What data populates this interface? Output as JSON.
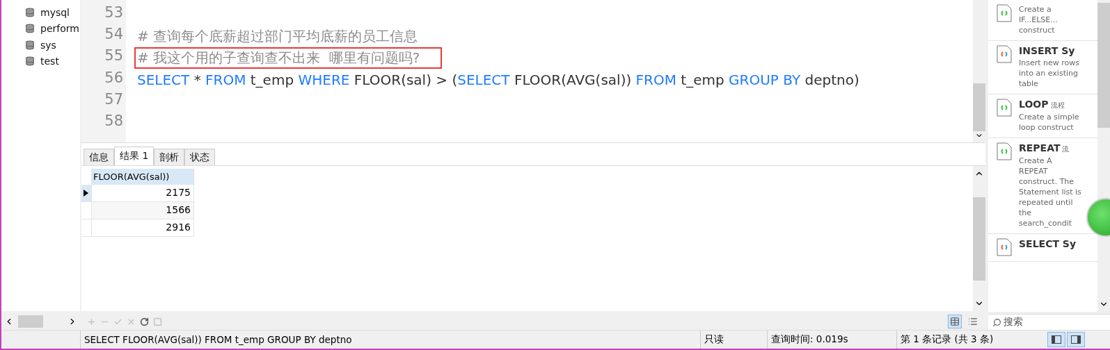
{
  "sidebar": {
    "items": [
      {
        "name": "mysql"
      },
      {
        "name": "perform"
      },
      {
        "name": "sys"
      },
      {
        "name": "test"
      }
    ]
  },
  "editor": {
    "lines": [
      {
        "number": "53"
      },
      {
        "number": "54",
        "highlighted": false,
        "tokens": [
          {
            "kind": "comment",
            "text": "# 查询每个底薪超过部门平均底薪的员工信息"
          }
        ]
      },
      {
        "number": "55",
        "highlighted": true,
        "tokens": [
          {
            "kind": "comment",
            "text": "# 我这个用的子查询查不出来  哪里有问题吗?"
          }
        ]
      },
      {
        "number": "56",
        "highlighted": false,
        "tokens": [
          {
            "kind": "keyword",
            "text": "SELECT"
          },
          {
            "kind": "plain",
            "text": " * "
          },
          {
            "kind": "keyword",
            "text": "FROM"
          },
          {
            "kind": "plain",
            "text": " t_emp "
          },
          {
            "kind": "keyword",
            "text": "WHERE"
          },
          {
            "kind": "plain",
            "text": " FLOOR(sal) > ("
          },
          {
            "kind": "keyword",
            "text": "SELECT"
          },
          {
            "kind": "plain",
            "text": " FLOOR(AVG(sal)) "
          },
          {
            "kind": "keyword",
            "text": "FROM"
          },
          {
            "kind": "plain",
            "text": " t_emp "
          },
          {
            "kind": "keyword",
            "text": "GROUP BY"
          },
          {
            "kind": "plain",
            "text": " deptno)"
          }
        ]
      },
      {
        "number": "57"
      },
      {
        "number": "58"
      }
    ]
  },
  "result_tabs": [
    {
      "label": "信息",
      "selected": false
    },
    {
      "label": "结果 1",
      "selected": true
    },
    {
      "label": "剖析",
      "selected": false
    },
    {
      "label": "状态",
      "selected": false
    }
  ],
  "grid": {
    "columns": [
      "FLOOR(AVG(sal))"
    ],
    "rows": [
      {
        "selected": true,
        "cells": [
          "2175"
        ]
      },
      {
        "selected": false,
        "cells": [
          "1566"
        ]
      },
      {
        "selected": false,
        "cells": [
          "2916"
        ]
      }
    ]
  },
  "toolbar": [
    {
      "kind": "add",
      "disabled": true
    },
    {
      "kind": "remove",
      "disabled": true
    },
    {
      "kind": "apply",
      "disabled": true
    },
    {
      "kind": "discard",
      "disabled": true
    },
    {
      "kind": "refresh",
      "disabled": false
    },
    {
      "kind": "stop",
      "disabled": true
    }
  ],
  "view_buttons": [
    {
      "kind": "grid",
      "selected": true
    },
    {
      "kind": "form",
      "selected": false
    }
  ],
  "snippets": [
    {
      "kind": "flow",
      "description": "Create a IF...ELSE... construct"
    },
    {
      "kind": "statement",
      "title": "INSERT Sy",
      "description": "Insert new rows into an existing table"
    },
    {
      "kind": "flow",
      "title": "LOOP",
      "tag": "流程",
      "description": "Create a simple loop construct"
    },
    {
      "kind": "flow",
      "title": "REPEAT",
      "tag": "流",
      "description": "Create A REPEAT construct. The Statement list is repeated until the search_condit"
    },
    {
      "kind": "statement",
      "title": "SELECT Sy"
    }
  ],
  "search": {
    "placeholder": "搜索"
  },
  "status_bar": {
    "query": "SELECT FLOOR(AVG(sal)) FROM t_emp GROUP BY deptno",
    "mode": "只读",
    "time": "查询时间: 0.019s",
    "records": "第 1 条记录 (共 3 条)"
  }
}
